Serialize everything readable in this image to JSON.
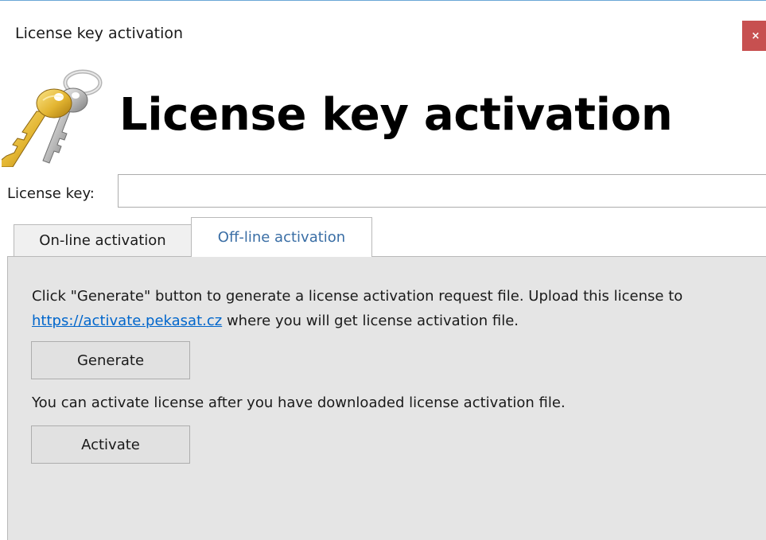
{
  "window": {
    "title": "License key activation",
    "close_label": "×"
  },
  "header": {
    "heading": "License key activation",
    "icon": "keys-icon"
  },
  "license": {
    "label": "License key:",
    "value": "",
    "placeholder": ""
  },
  "tabs": [
    {
      "label": "On-line activation",
      "active": false
    },
    {
      "label": "Off-line activation",
      "active": true
    }
  ],
  "offline": {
    "instructions_before_link": "Click \"Generate\" button to generate a license activation request file. Upload this license to ",
    "link_text": "https://activate.pekasat.cz",
    "instructions_after_link": " where you will get license activation file.",
    "generate_label": "Generate",
    "activate_note": "You can activate license after you have downloaded license activation file.",
    "activate_label": "Activate"
  },
  "colors": {
    "close_button": "#c75050",
    "active_tab_text": "#3a6ea5",
    "link": "#0066cc",
    "panel_background": "#e5e5e5"
  }
}
